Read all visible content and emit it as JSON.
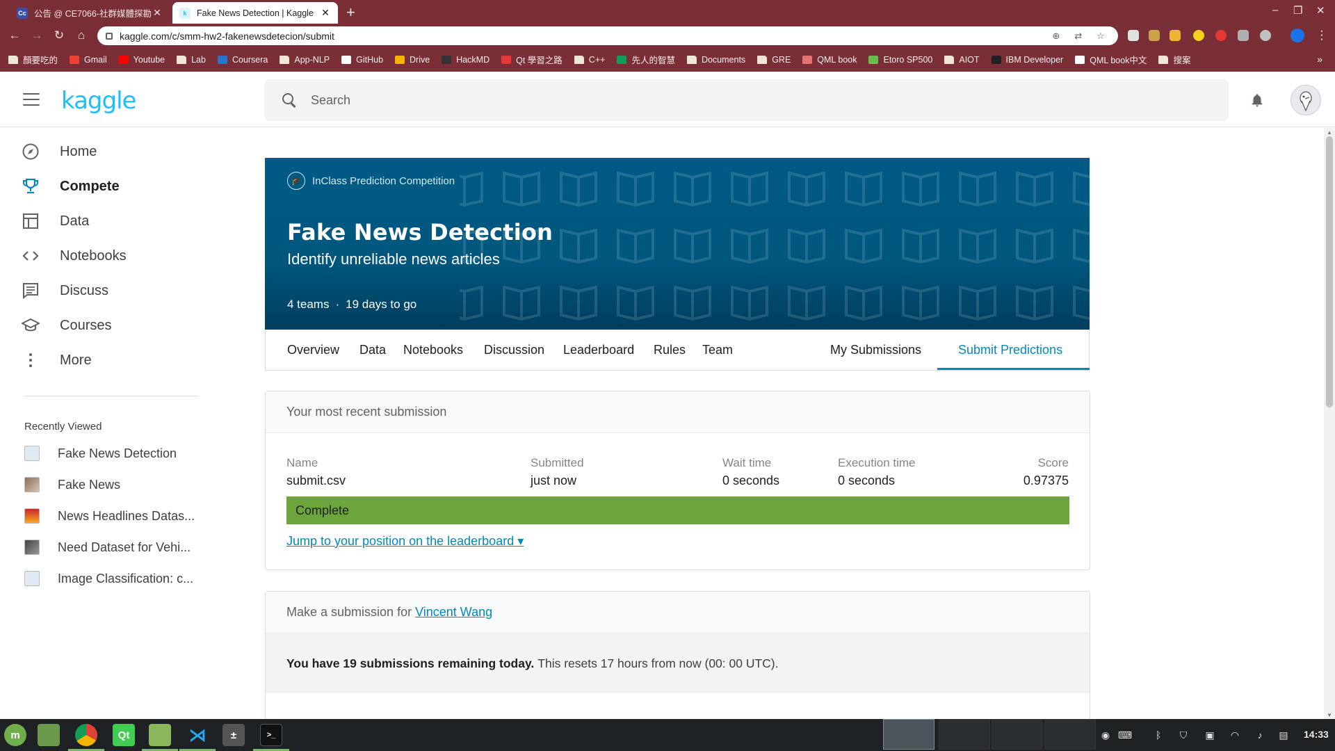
{
  "browser": {
    "tabs": [
      {
        "title": "公告 @ CE7066-社群媒體探勘",
        "favicon": "Cc",
        "active": false
      },
      {
        "title": "Fake News Detection | Kaggle",
        "favicon": "k",
        "active": true
      }
    ],
    "url": "kaggle.com/c/smm-hw2-fakenewsdetecion/submit",
    "bookmarks": [
      "顏要吃的",
      "Gmail",
      "Youtube",
      "Lab",
      "Coursera",
      "App-NLP",
      "GitHub",
      "Drive",
      "HackMD",
      "Qt 學習之路",
      "C++",
      "先人的智慧",
      "Documents",
      "GRE",
      "QML book",
      "Etoro SP500",
      "AIOT",
      "IBM Developer",
      "QML book中文",
      "搜案"
    ],
    "colors": {
      "chrome_frame": "#7a2f36",
      "kaggle_blue": "#20beff",
      "accent": "#008abc",
      "complete_green": "#6ba53c",
      "banner": "#005b86"
    }
  },
  "header": {
    "logo": "kaggle",
    "search_placeholder": "Search"
  },
  "sidebar": {
    "items": [
      {
        "label": "Home",
        "icon": "compass-icon"
      },
      {
        "label": "Compete",
        "icon": "trophy-icon",
        "active": true
      },
      {
        "label": "Data",
        "icon": "table-icon"
      },
      {
        "label": "Notebooks",
        "icon": "code-icon"
      },
      {
        "label": "Discuss",
        "icon": "comment-icon"
      },
      {
        "label": "Courses",
        "icon": "graduation-cap-icon"
      },
      {
        "label": "More",
        "icon": "more-vertical-icon"
      }
    ],
    "recently_viewed_title": "Recently Viewed",
    "recently_viewed": [
      "Fake News Detection",
      "Fake News",
      "News Headlines Datas...",
      "Need Dataset for Vehi...",
      "Image Classification: c..."
    ]
  },
  "competition": {
    "type": "InClass Prediction Competition",
    "title": "Fake News Detection",
    "subtitle": "Identify unreliable news articles",
    "teams": "4 teams",
    "separator": "·",
    "deadline": "19 days to go",
    "tabs": [
      "Overview",
      "Data",
      "Notebooks",
      "Discussion",
      "Leaderboard",
      "Rules",
      "Team",
      "My Submissions",
      "Submit Predictions"
    ],
    "active_tab": "Submit Predictions"
  },
  "recent_submission": {
    "heading": "Your most recent submission",
    "columns": {
      "name": {
        "label": "Name",
        "value": "submit.csv"
      },
      "submitted": {
        "label": "Submitted",
        "value": "just now"
      },
      "wait": {
        "label": "Wait time",
        "value": "0 seconds"
      },
      "execution": {
        "label": "Execution time",
        "value": "0 seconds"
      },
      "score": {
        "label": "Score",
        "value": "0.97375"
      }
    },
    "status": "Complete",
    "jump_link": "Jump to your position on the leaderboard ▾"
  },
  "make_submission": {
    "prefix": "Make a submission for",
    "user": "Vincent Wang",
    "remaining_bold": "You have 19 submissions remaining today.",
    "remaining_rest": "This resets 17 hours from now (00: 00 UTC)."
  },
  "taskbar": {
    "clock": "14:33"
  }
}
